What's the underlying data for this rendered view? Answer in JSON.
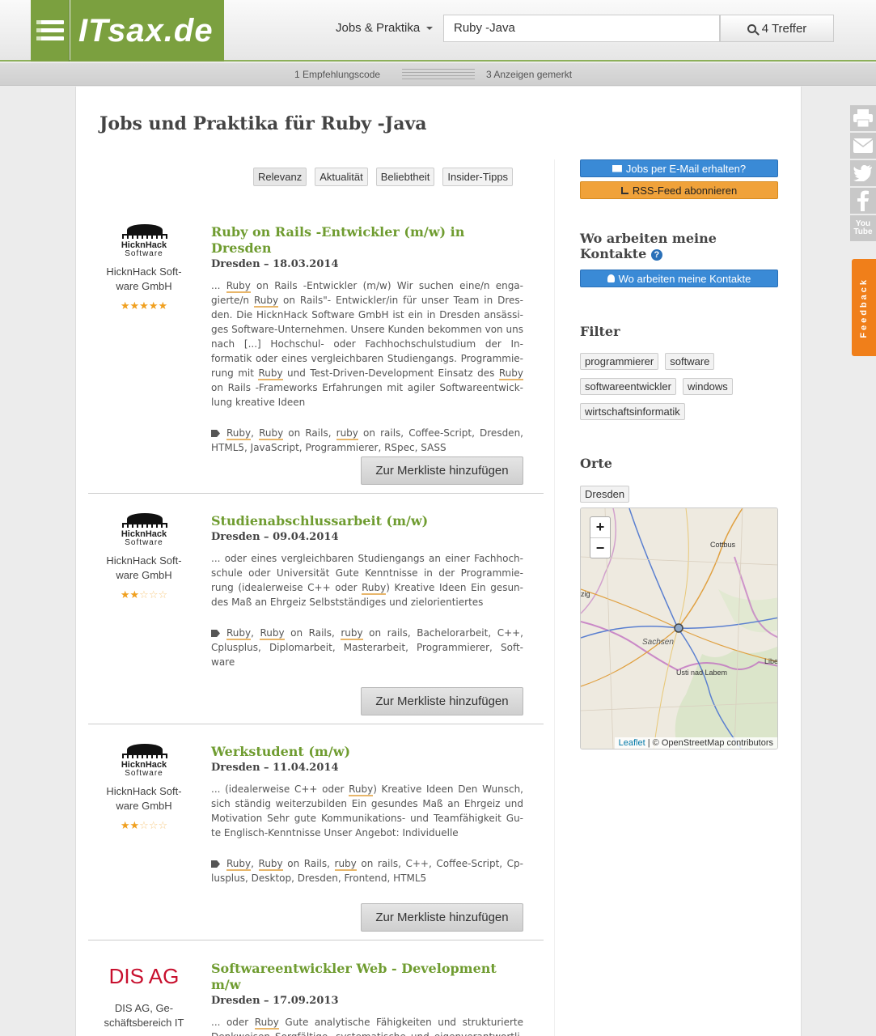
{
  "header": {
    "logo_text": "ITsax.de",
    "category_label": "Jobs & Praktika",
    "search_value": "Ruby -Java",
    "search_button_label": "4 Treffer",
    "accent_color": "#7ba03f"
  },
  "subbar": {
    "left": "1 Empfehlungscode",
    "right": "3 Anzeigen gemerkt"
  },
  "page": {
    "title": "Jobs und Praktika für Ruby -Java"
  },
  "sort_tabs": [
    "Relevanz",
    "Aktualität",
    "Beliebtheit",
    "Insider-Tipps"
  ],
  "listings": [
    {
      "company_logo": "HicknHack Software",
      "logo_line1": "HicknHack",
      "logo_line2": "Software",
      "company_name_1": "HicknHack Soft-",
      "company_name_2": "ware GmbH",
      "rating": "5 of 5 stars",
      "title": "Ruby on Rails -Entwickler (m/w) in Dresden",
      "meta": "Dresden – 18.03.2014",
      "button": "Zur Merkliste hinzufügen"
    },
    {
      "company_logo": "HicknHack Software",
      "logo_line1": "HicknHack",
      "logo_line2": "Software",
      "company_name_1": "HicknHack Soft-",
      "company_name_2": "ware GmbH",
      "rating": "2 of 5 stars",
      "title": "Studienabschlussarbeit (m/w)",
      "meta": "Dresden – 09.04.2014",
      "button": "Zur Merkliste hinzufügen"
    },
    {
      "company_logo": "HicknHack Software",
      "logo_line1": "HicknHack",
      "logo_line2": "Software",
      "company_name_1": "HicknHack Soft-",
      "company_name_2": "ware GmbH",
      "rating": "2 of 5 stars",
      "title": "Werkstudent (m/w)",
      "meta": "Dresden – 11.04.2014",
      "button": "Zur Merkliste hinzufügen"
    },
    {
      "company_logo": "DIS AG",
      "company_name_1": "DIS AG, Ge-",
      "company_name_2": "schäftsbereich IT",
      "title": "Softwareentwickler Web - Development m/w",
      "meta": "Dresden – 17.09.2013",
      "desc_a": "... oder ",
      "desc_hl": "Ruby",
      "desc_b": " Gute analytische Fähigkeiten und strukturierte Denkweisen Sorgfältige, systematische und eigenverantwortli- che Arbeitsweise ... Spannende Jobs und interessante Projekte"
    }
  ],
  "desc1": {
    "p1": "... ",
    "h1": "Ruby",
    "p2": " on Rails -Entwickler (m/w) Wir suchen eine/n enga- gierte/n ",
    "h2": "Ruby",
    "p3": " on Rails\"- Entwickler/in für unser Team in Dres- den. Die HicknHack Software GmbH ist ein in Dresden ansässi- ges Software-Unternehmen. Unsere Kunden bekommen von uns nach [...] Hochschul- oder Fachhochschulstudium der In- formatik oder eines vergleichbaren Studiengangs. Programmie- rung mit ",
    "h3": "Ruby",
    "p4": " und Test-Driven-Development Einsatz des ",
    "h4": "Ruby",
    "p5": " on Rails -Frameworks Erfahrungen mit agiler Softwareentwick- lung kreative Ideen"
  },
  "tags1": {
    "h1": "Ruby",
    "p1": ", ",
    "h2": "Ruby",
    "p2": " on Rails, ",
    "h3": "ruby",
    "p3": " on rails, Coffee-Script, Dresden, HTML5, JavaScript, Programmierer, RSpec, SASS"
  },
  "desc2": {
    "p1": "... oder eines vergleichbaren Studiengangs an einer Fachhoch- schule oder Universität Gute Kenntnisse in der Programmie- rung (idealerweise C++ oder ",
    "h1": "Ruby",
    "p2": ") Kreative Ideen Ein gesun- des Maß an Ehrgeiz Selbstständiges und zielorientiertes"
  },
  "tags2": {
    "h1": "Ruby",
    "p1": ", ",
    "h2": "Ruby",
    "p2": " on Rails, ",
    "h3": "ruby",
    "p3": " on rails, Bachelorarbeit, C++, Cplusplus, Diplomarbeit, Masterarbeit, Programmierer, Soft- ware"
  },
  "desc3": {
    "p1": "... (idealerweise C++ oder ",
    "h1": "Ruby",
    "p2": ") Kreative Ideen Den Wunsch, sich ständig weiterzubilden Ein gesundes Maß an Ehrgeiz und Motivation Sehr gute Kommunikations- und Teamfähigkeit Gu- te Englisch-Kenntnisse Unser Angebot: Individuelle"
  },
  "tags3": {
    "h1": "Ruby",
    "p1": ", ",
    "h2": "Ruby",
    "p2": " on Rails, ",
    "h3": "ruby",
    "p3": " on rails, C++, Coffee-Script, Cp- lusplus, Desktop, Dresden, Frontend, HTML5"
  },
  "sidebar": {
    "email_button": "Jobs per E-Mail erhalten?",
    "rss_button": "RSS-Feed abonnieren",
    "contacts_heading": "Wo arbeiten meine Kontakte",
    "help_icon": "?",
    "contacts_button": "Wo arbeiten meine Kontakte",
    "filter_heading": "Filter",
    "filters": [
      "programmierer",
      "software",
      "softwareentwickler",
      "windows",
      "wirtschaftsinformatik"
    ],
    "orte_heading": "Orte",
    "orte": [
      "Dresden"
    ]
  },
  "map": {
    "zoom_in": "+",
    "zoom_out": "−",
    "labels": {
      "cottbus": "Cottbus",
      "sachsen": "Sachsen",
      "usti": "Usti nad Labem",
      "zig": "zig",
      "libe": "Libe"
    },
    "attr_link": "Leaflet",
    "attr_sep": " | © ",
    "attr_rest": "OpenStreetMap contributors"
  },
  "social": {
    "icons": [
      "print-icon",
      "mail-icon",
      "twitter-icon",
      "facebook-icon",
      "youtube-icon"
    ],
    "youtube_label": "You Tube",
    "feedback_label": "Feedback",
    "feedback_color": "#f07f1a"
  }
}
